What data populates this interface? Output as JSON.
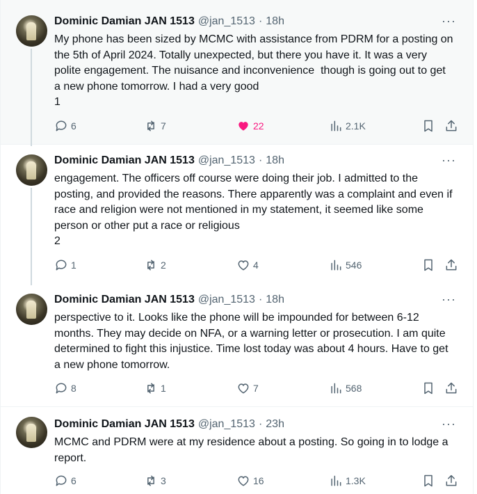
{
  "tweets": [
    {
      "name": "Dominic Damian JAN 1513",
      "handle": "@jan_1513",
      "dot": "·",
      "time": "18h",
      "more": "···",
      "text": "My phone has been sized by MCMC with assistance from PDRM for a posting on the 5th of April 2024. Totally unexpected, but there you have it. It was a very polite engagement. The nuisance and inconvenience  though is going out to get a new phone tomorrow. I had a very good\n1",
      "replies": "6",
      "reposts": "7",
      "likes": "22",
      "liked": true,
      "views": "2.1K"
    },
    {
      "name": "Dominic Damian JAN 1513",
      "handle": "@jan_1513",
      "dot": "·",
      "time": "18h",
      "more": "···",
      "text": "engagement. The officers off course were doing their job. I admitted to the posting, and provided the reasons. There apparently was a complaint and even if race and religion were not mentioned in my statement, it seemed like some person or other put a race or religious\n2",
      "replies": "1",
      "reposts": "2",
      "likes": "4",
      "liked": false,
      "views": "546"
    },
    {
      "name": "Dominic Damian JAN 1513",
      "handle": "@jan_1513",
      "dot": "·",
      "time": "18h",
      "more": "···",
      "text": "perspective to it. Looks like the phone will be impounded for between 6-12 months. They may decide on NFA, or a warning letter or prosecution. I am quite determined to fight this injustice. Time lost today was about 4 hours. Have to get a new phone tomorrow.",
      "replies": "8",
      "reposts": "1",
      "likes": "7",
      "liked": false,
      "views": "568"
    },
    {
      "name": "Dominic Damian JAN 1513",
      "handle": "@jan_1513",
      "dot": "·",
      "time": "23h",
      "more": "···",
      "text": "MCMC and PDRM were at my residence about a posting. So going in to lodge a report.",
      "replies": "6",
      "reposts": "3",
      "likes": "16",
      "liked": false,
      "views": "1.3K"
    }
  ],
  "colors": {
    "accent_like": "#f91880",
    "muted": "#536471",
    "text": "#0f1419",
    "divider": "#eff3f4"
  },
  "icons": [
    "reply-icon",
    "repost-icon",
    "like-icon",
    "views-icon",
    "bookmark-icon",
    "share-icon",
    "more-icon"
  ]
}
